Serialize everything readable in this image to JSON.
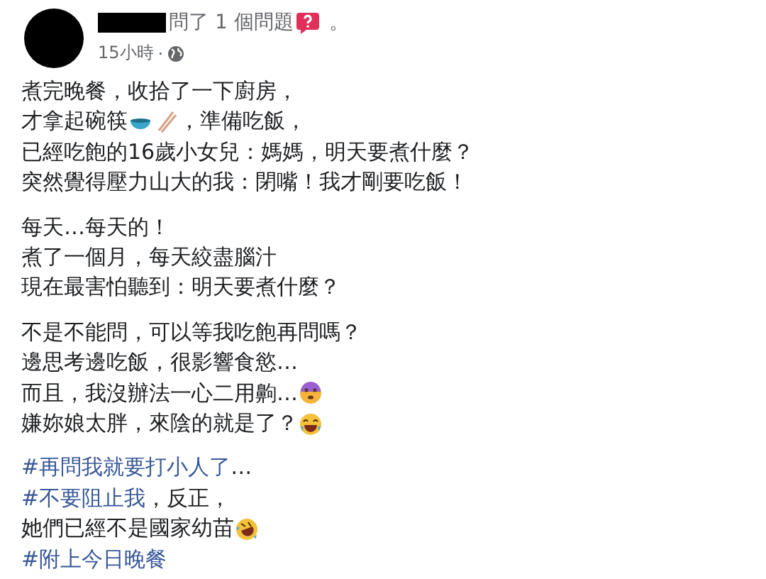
{
  "header": {
    "question_text": "問了 1 個問題",
    "end_mark": "。",
    "time": "15小時",
    "separator": "·"
  },
  "paragraphs": [
    {
      "lines": [
        [
          {
            "kind": "text",
            "text": "煮完晚餐，收拾了一下廚房，"
          }
        ],
        [
          {
            "kind": "text",
            "text": "才拿起碗筷"
          },
          {
            "kind": "bowl"
          },
          {
            "kind": "chopsticks"
          },
          {
            "kind": "text",
            "text": "，準備吃飯，"
          }
        ],
        [
          {
            "kind": "text",
            "text": "已經吃飽的16歲小女兒：媽媽，明天要煮什麼？"
          }
        ],
        [
          {
            "kind": "text",
            "text": "突然覺得壓力山大的我：閉嘴！我才剛要吃飯！"
          }
        ]
      ]
    },
    {
      "lines": [
        [
          {
            "kind": "text",
            "text": "每天…每天的！"
          }
        ],
        [
          {
            "kind": "text",
            "text": "煮了一個月，每天絞盡腦汁"
          }
        ],
        [
          {
            "kind": "text",
            "text": "現在最害怕聽到：明天要煮什麼？"
          }
        ]
      ]
    },
    {
      "lines": [
        [
          {
            "kind": "text",
            "text": "不是不能問，可以等我吃飽再問嗎？"
          }
        ],
        [
          {
            "kind": "text",
            "text": "邊思考邊吃飯，很影響食慾…"
          }
        ],
        [
          {
            "kind": "text",
            "text": "而且，我沒辦法一心二用齁…"
          },
          {
            "kind": "dizzy"
          }
        ],
        [
          {
            "kind": "text",
            "text": "嫌妳娘太胖，來陰的就是了？"
          },
          {
            "kind": "joy"
          }
        ]
      ]
    },
    {
      "lines": [
        [
          {
            "kind": "hashtag",
            "text": "#再問我就要打小人了"
          },
          {
            "kind": "text",
            "text": "…"
          }
        ],
        [
          {
            "kind": "hashtag",
            "text": "#不要阻止我"
          },
          {
            "kind": "text",
            "text": "，反正，"
          }
        ],
        [
          {
            "kind": "text",
            "text": "她們已經不是國家幼苗"
          },
          {
            "kind": "rofl"
          }
        ],
        [
          {
            "kind": "hashtag",
            "text": "#附上今日晚餐"
          }
        ]
      ]
    }
  ]
}
